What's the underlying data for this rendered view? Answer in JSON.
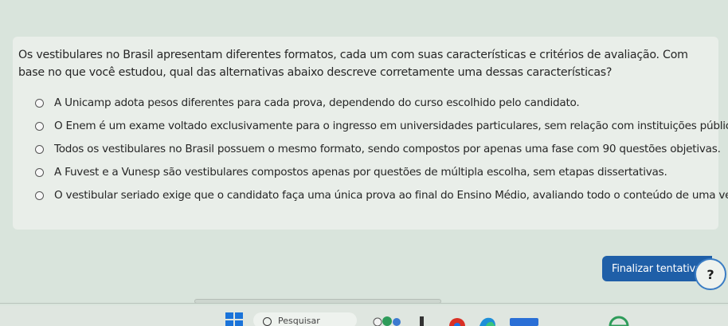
{
  "question": {
    "text": "Os vestibulares no Brasil apresentam diferentes formatos, cada um com suas características e critérios de avaliação. Com base no que você estudou, qual das alternativas abaixo descreve corretamente uma dessas características?",
    "options": [
      {
        "label": "A Unicamp adota pesos diferentes para cada prova, dependendo do curso escolhido pelo candidato."
      },
      {
        "label": "O Enem é um exame voltado exclusivamente para o ingresso em universidades particulares, sem relação com instituições públicas."
      },
      {
        "label": "Todos os vestibulares no Brasil possuem o mesmo formato, sendo compostos por apenas uma fase com 90 questões objetivas."
      },
      {
        "label": "A Fuvest e a Vunesp são vestibulares compostos apenas por questões de múltipla escolha, sem etapas dissertativas."
      },
      {
        "label": "O vestibular seriado exige que o candidato faça uma única prova ao final do Ensino Médio, avaliando todo o conteúdo de uma vez."
      }
    ]
  },
  "actions": {
    "finalize_label": "Finalizar tentativa",
    "help_label": "?"
  },
  "taskbar": {
    "search_label": "Pesquisar",
    "start_icon": "windows-start-icon",
    "search_icon": "search-icon"
  },
  "colors": {
    "background": "#d9e4dc",
    "card": "#e9eee9",
    "primary_button": "#1f5fa8",
    "windows_blue": "#1a73d9"
  }
}
